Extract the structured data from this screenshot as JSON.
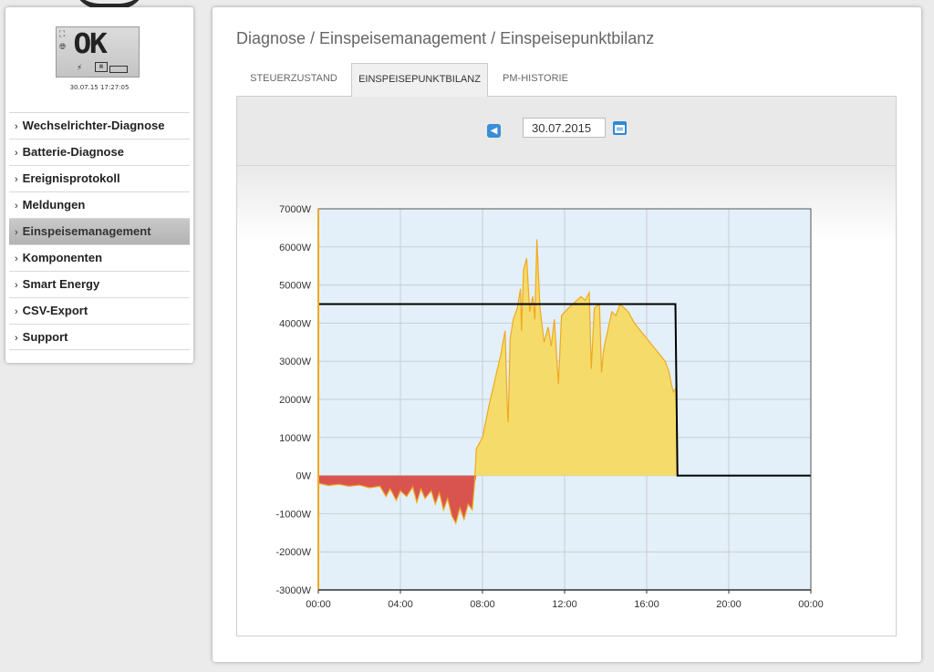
{
  "device": {
    "status_display": "OK",
    "datetime": "30.07.15 17:27:05"
  },
  "sidebar": {
    "items": [
      {
        "label": "Wechselrichter-Diagnose"
      },
      {
        "label": "Batterie-Diagnose"
      },
      {
        "label": "Ereignisprotokoll"
      },
      {
        "label": "Meldungen"
      },
      {
        "label": "Einspeisemanagement",
        "active": true
      },
      {
        "label": "Komponenten"
      },
      {
        "label": "Smart Energy"
      },
      {
        "label": "CSV-Export"
      },
      {
        "label": "Support"
      }
    ]
  },
  "header": {
    "breadcrumb": "Diagnose / Einspeisemanagement / Einspeisepunktbilanz"
  },
  "tabs": [
    {
      "label": "STEUERZUSTAND"
    },
    {
      "label": "EINSPEISEPUNKTBILANZ",
      "active": true
    },
    {
      "label": "PM-HISTORIE"
    }
  ],
  "date_picker": {
    "value": "30.07.2015",
    "prev_icon": "arrow-left-icon",
    "calendar_icon": "calendar-icon"
  },
  "colors": {
    "feed_in": "#f5dc6a",
    "feed_in_line": "#f0a820",
    "consumption": "#d9544f",
    "consumption_line": "#e08a2c",
    "limit_line": "#000000",
    "plot_background": "#e3f0f9",
    "nav_button": "#3a8fd6"
  },
  "chart_data": {
    "type": "area",
    "y_unit": "W",
    "x_ticks": [
      "00:00",
      "04:00",
      "08:00",
      "12:00",
      "16:00",
      "20:00",
      "00:00"
    ],
    "y_ticks": [
      "7000W",
      "6000W",
      "5000W",
      "4000W",
      "3000W",
      "2000W",
      "1000W",
      "0W",
      "-1000W",
      "-2000W",
      "-3000W"
    ],
    "ylim": [
      -3000,
      7000
    ],
    "xlim_hours": [
      0,
      24
    ],
    "grid": true,
    "series": [
      {
        "kind": "area",
        "points": [
          [
            0.0,
            -200
          ],
          [
            0.5,
            -260
          ],
          [
            1.0,
            -230
          ],
          [
            1.5,
            -280
          ],
          [
            2.0,
            -250
          ],
          [
            2.5,
            -320
          ],
          [
            3.0,
            -280
          ],
          [
            3.3,
            -550
          ],
          [
            3.5,
            -350
          ],
          [
            3.8,
            -650
          ],
          [
            4.0,
            -400
          ],
          [
            4.3,
            -550
          ],
          [
            4.6,
            -300
          ],
          [
            4.8,
            -700
          ],
          [
            5.0,
            -350
          ],
          [
            5.2,
            -600
          ],
          [
            5.5,
            -400
          ],
          [
            5.7,
            -750
          ],
          [
            5.9,
            -450
          ],
          [
            6.1,
            -900
          ],
          [
            6.3,
            -600
          ],
          [
            6.5,
            -1050
          ],
          [
            6.7,
            -1250
          ],
          [
            6.9,
            -850
          ],
          [
            7.1,
            -1150
          ],
          [
            7.3,
            -750
          ],
          [
            7.5,
            -900
          ],
          [
            7.6,
            -300
          ],
          [
            7.7,
            700
          ],
          [
            8.0,
            1000
          ],
          [
            8.3,
            1800
          ],
          [
            8.6,
            2500
          ],
          [
            8.9,
            3200
          ],
          [
            9.1,
            3800
          ],
          [
            9.2,
            1900
          ],
          [
            9.25,
            1400
          ],
          [
            9.35,
            3600
          ],
          [
            9.5,
            4100
          ],
          [
            9.7,
            4400
          ],
          [
            9.85,
            4900
          ],
          [
            9.9,
            3800
          ],
          [
            10.0,
            5400
          ],
          [
            10.15,
            5700
          ],
          [
            10.3,
            4300
          ],
          [
            10.45,
            4700
          ],
          [
            10.55,
            4100
          ],
          [
            10.65,
            6200
          ],
          [
            10.8,
            4400
          ],
          [
            11.0,
            3500
          ],
          [
            11.2,
            3900
          ],
          [
            11.35,
            3400
          ],
          [
            11.5,
            4100
          ],
          [
            11.7,
            2400
          ],
          [
            11.85,
            4200
          ],
          [
            12.2,
            4400
          ],
          [
            12.6,
            4600
          ],
          [
            12.8,
            4700
          ],
          [
            13.0,
            4600
          ],
          [
            13.2,
            4800
          ],
          [
            13.3,
            2800
          ],
          [
            13.45,
            4400
          ],
          [
            13.7,
            4500
          ],
          [
            13.8,
            2700
          ],
          [
            13.9,
            3300
          ],
          [
            14.1,
            3800
          ],
          [
            14.3,
            4300
          ],
          [
            14.5,
            4200
          ],
          [
            14.7,
            4500
          ],
          [
            14.9,
            4400
          ],
          [
            15.1,
            4300
          ],
          [
            15.4,
            4000
          ],
          [
            15.7,
            3800
          ],
          [
            16.0,
            3600
          ],
          [
            16.3,
            3400
          ],
          [
            16.6,
            3200
          ],
          [
            16.9,
            3000
          ],
          [
            17.1,
            2700
          ],
          [
            17.2,
            2400
          ],
          [
            17.3,
            2200
          ],
          [
            17.45,
            2300
          ],
          [
            17.5,
            0
          ],
          [
            24.0,
            0
          ]
        ]
      },
      {
        "kind": "limit-line",
        "points": [
          [
            0,
            4500
          ],
          [
            17.4,
            4500
          ],
          [
            17.5,
            0
          ],
          [
            24,
            0
          ]
        ]
      }
    ]
  }
}
